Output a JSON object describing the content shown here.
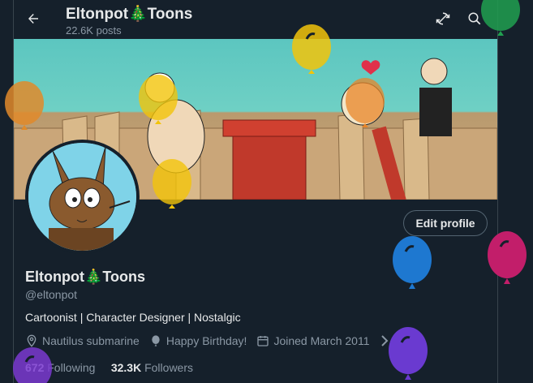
{
  "header": {
    "title": "Eltonpot🎄Toons",
    "posts_count": "22.6K posts"
  },
  "profile": {
    "edit_label": "Edit profile",
    "name": "Eltonpot🎄Toons",
    "handle": "@eltonpot",
    "bio": "Cartoonist | Character Designer | Nostalgic",
    "location": "Nautilus submarine",
    "birthday": "Happy Birthday!",
    "joined": "Joined March 2011",
    "following_count": "672",
    "following_label": "Following",
    "followers_count": "32.3K",
    "followers_label": "Followers"
  },
  "icons": {
    "back": "back-arrow-icon",
    "refresh": "refresh-icon",
    "search": "search-icon",
    "location": "location-pin-icon",
    "birthday": "balloon-icon",
    "calendar": "calendar-icon",
    "chevron": "chevron-right-icon"
  },
  "colors": {
    "background": "#15202b",
    "text": "#e7e9ea",
    "muted": "#8b98a5",
    "balloons": [
      "#20a050",
      "#f2c40a",
      "#e08a2a",
      "#f2c40a",
      "#e8862a",
      "#f2c40a",
      "#1e78d0",
      "#c21e6a",
      "#6a3ad0",
      "#7a3ad0"
    ]
  }
}
